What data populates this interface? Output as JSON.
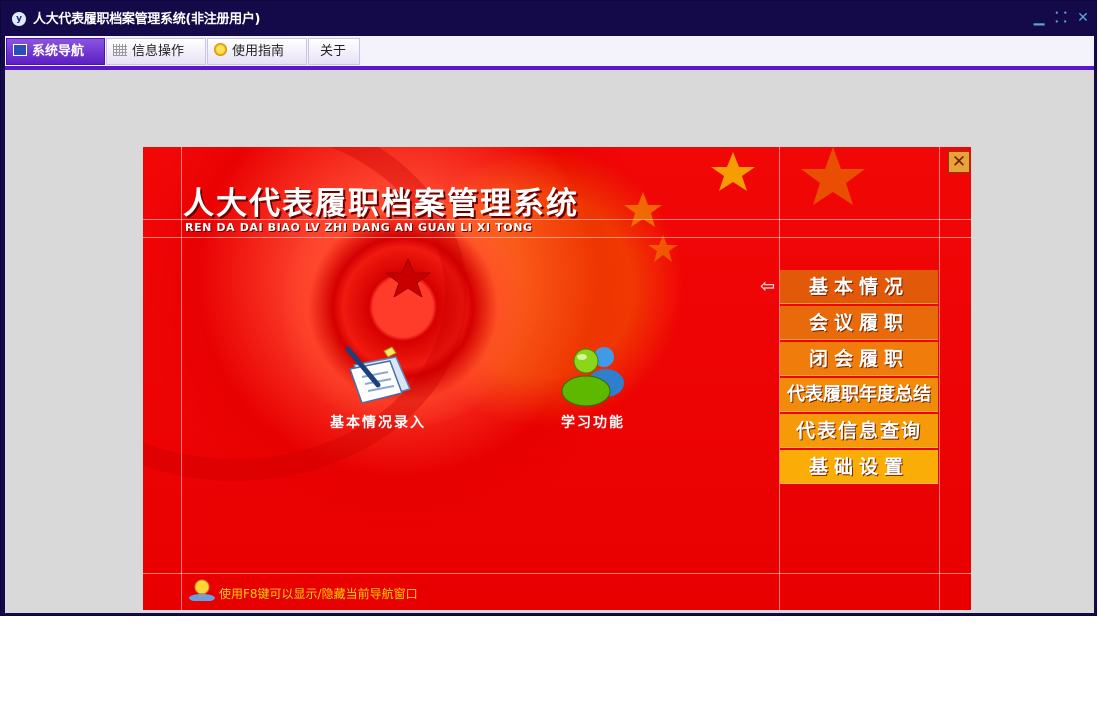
{
  "window": {
    "title": "人大代表履职档案管理系统(非注册用户)",
    "app_icon_glyph": "y",
    "controls": {
      "minimize": "▁",
      "restore": "⸬",
      "close": "✕"
    }
  },
  "menu_tabs": [
    {
      "label": "系统导航",
      "icon": "monitor-icon",
      "active": true
    },
    {
      "label": "信息操作",
      "icon": "grid-icon",
      "active": false
    },
    {
      "label": "使用指南",
      "icon": "help-icon",
      "active": false
    },
    {
      "label": "关于",
      "icon": "",
      "active": false
    }
  ],
  "panel": {
    "close_glyph": "✕",
    "system_title": "人大代表履职档案管理系统",
    "system_subtitle": "REN DA DAI BIAO LV ZHI DANG AN GUAN LI XI TONG",
    "nav_arrow": "⇦",
    "side_menu": [
      {
        "label": "基本情况",
        "color": "#e25a09"
      },
      {
        "label": "会议履职",
        "color": "#e86a0a"
      },
      {
        "label": "闭会履职",
        "color": "#ef7c0b"
      },
      {
        "label": "代表履职年度总结",
        "color": "#f28a0a"
      },
      {
        "label": "代表信息查询",
        "color": "#f69a08"
      },
      {
        "label": "基础设置",
        "color": "#f9ad06"
      }
    ],
    "features": [
      {
        "label": "基本情况录入",
        "icon": "document-edit-icon"
      },
      {
        "label": "学习功能",
        "icon": "users-icon"
      }
    ],
    "tip": "使用F8键可以显示/隐藏当前导航窗口"
  },
  "colors": {
    "titlebar": "#140a4a",
    "menu_accent": "#5a19c8",
    "panel_red": "#ee0000",
    "tip_text": "#ffd100"
  }
}
